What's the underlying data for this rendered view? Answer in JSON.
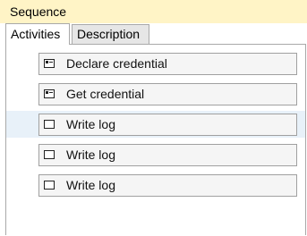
{
  "window": {
    "title": "Sequence"
  },
  "tabs": [
    {
      "label": "Activities",
      "active": true
    },
    {
      "label": "Description",
      "active": false
    }
  ],
  "activities": [
    {
      "label": "Declare credential",
      "icon": "credential-card-icon",
      "selected": false
    },
    {
      "label": "Get credential",
      "icon": "credential-card-icon",
      "selected": false
    },
    {
      "label": "Write log",
      "icon": "checkbox-icon",
      "selected": true
    },
    {
      "label": "Write log",
      "icon": "checkbox-icon",
      "selected": false
    },
    {
      "label": "Write log",
      "icon": "checkbox-icon",
      "selected": false
    }
  ],
  "colors": {
    "titlebar_bg": "#fff4c6",
    "selected_row_bg": "#e8f1f9",
    "activity_bg": "#f5f5f5",
    "border": "#a9a9a9"
  }
}
